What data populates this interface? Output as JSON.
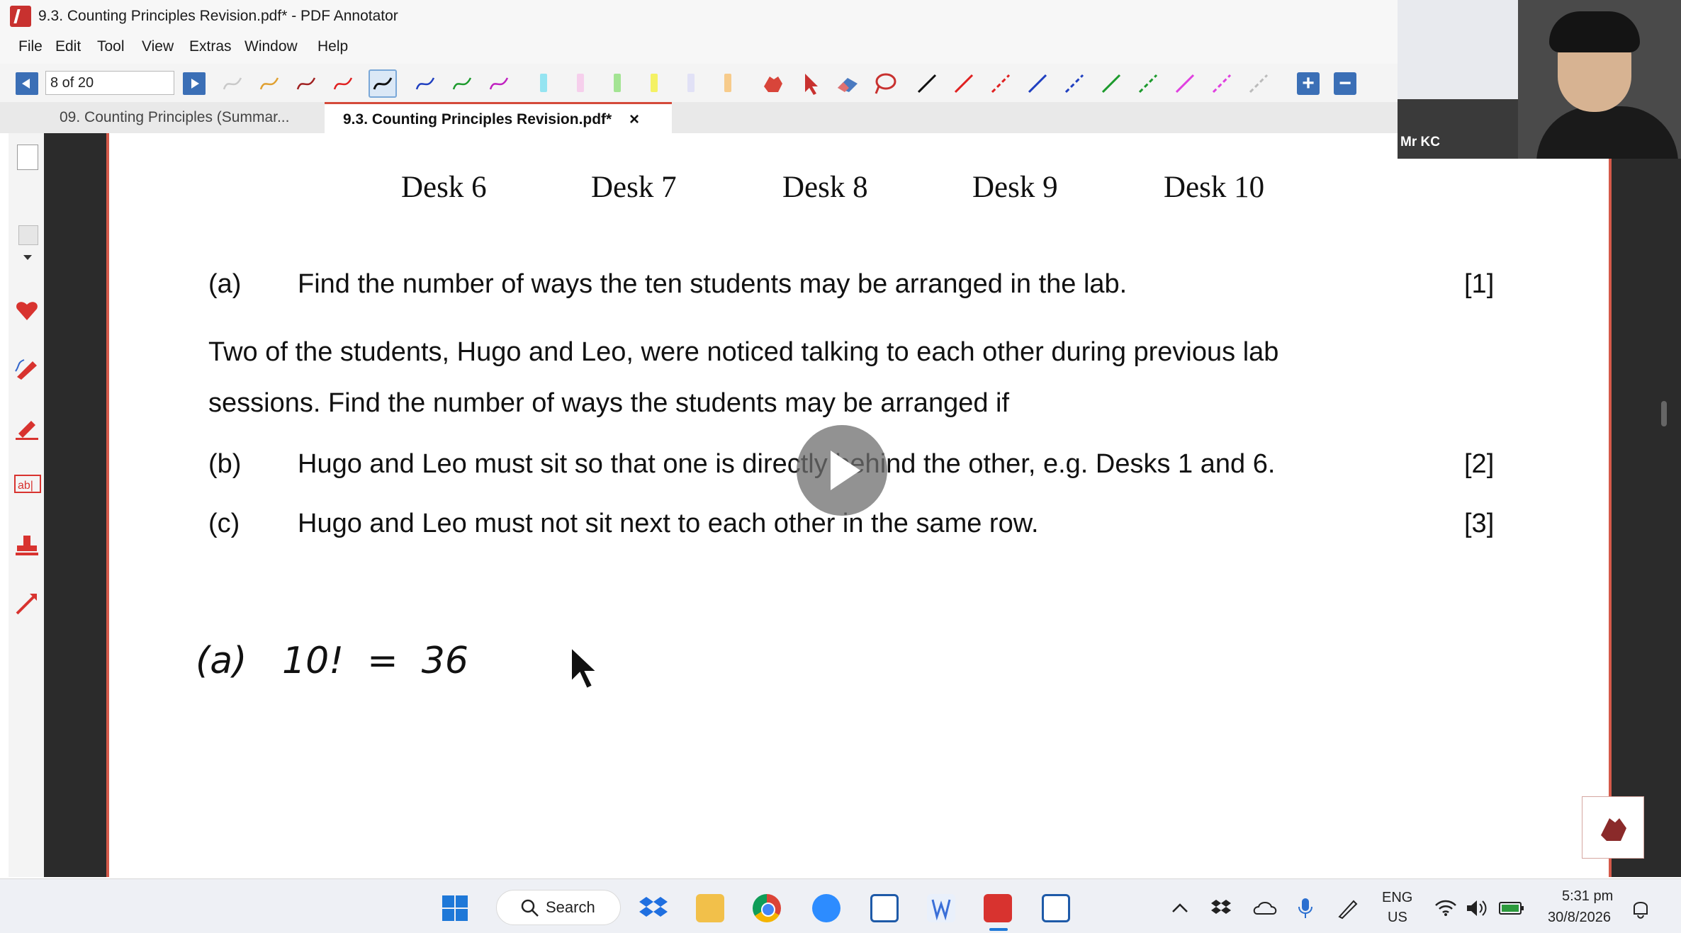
{
  "window": {
    "title": "9.3. Counting Principles Revision.pdf* - PDF Annotator"
  },
  "menu": [
    "File",
    "Edit",
    "Tool",
    "View",
    "Extras",
    "Window",
    "Help"
  ],
  "toolbar": {
    "page_indicator": "8 of 20"
  },
  "tabs": [
    {
      "label": "09. Counting Principles (Summar...",
      "active": false
    },
    {
      "label": "9.3. Counting Principles Revision.pdf*",
      "active": true
    }
  ],
  "tab_close_symbol": "×",
  "document": {
    "desks": [
      "Desk 6",
      "Desk 7",
      "Desk 8",
      "Desk 9",
      "Desk 10"
    ],
    "q_a_label": "(a)",
    "q_a_text": "Find the number of ways the ten students may be arranged in the lab.",
    "q_a_mark": "[1]",
    "intro_line1": "Two of the students, Hugo and Leo, were noticed talking to each other during previous lab",
    "intro_line2": "sessions. Find the number of ways the students may be arranged if",
    "q_b_label": "(b)",
    "q_b_text": "Hugo and Leo must sit so that one is directly behind the other, e.g. Desks 1 and 6.",
    "q_b_mark": "[2]",
    "q_c_label": "(c)",
    "q_c_text": "Hugo and Leo must not sit next to each other in the same row.",
    "q_c_mark": "[3]",
    "handwriting": "(a)   10!  =  36"
  },
  "webcam": {
    "name": "Mr KC"
  },
  "taskbar": {
    "search_label": "Search",
    "language": "ENG",
    "region": "US",
    "time": "5:31 pm",
    "date": "30/8/2026"
  },
  "colors": {
    "accent": "#3b6fb6",
    "page_border": "#d55a4a",
    "doc_bg": "#2b2b2b"
  }
}
